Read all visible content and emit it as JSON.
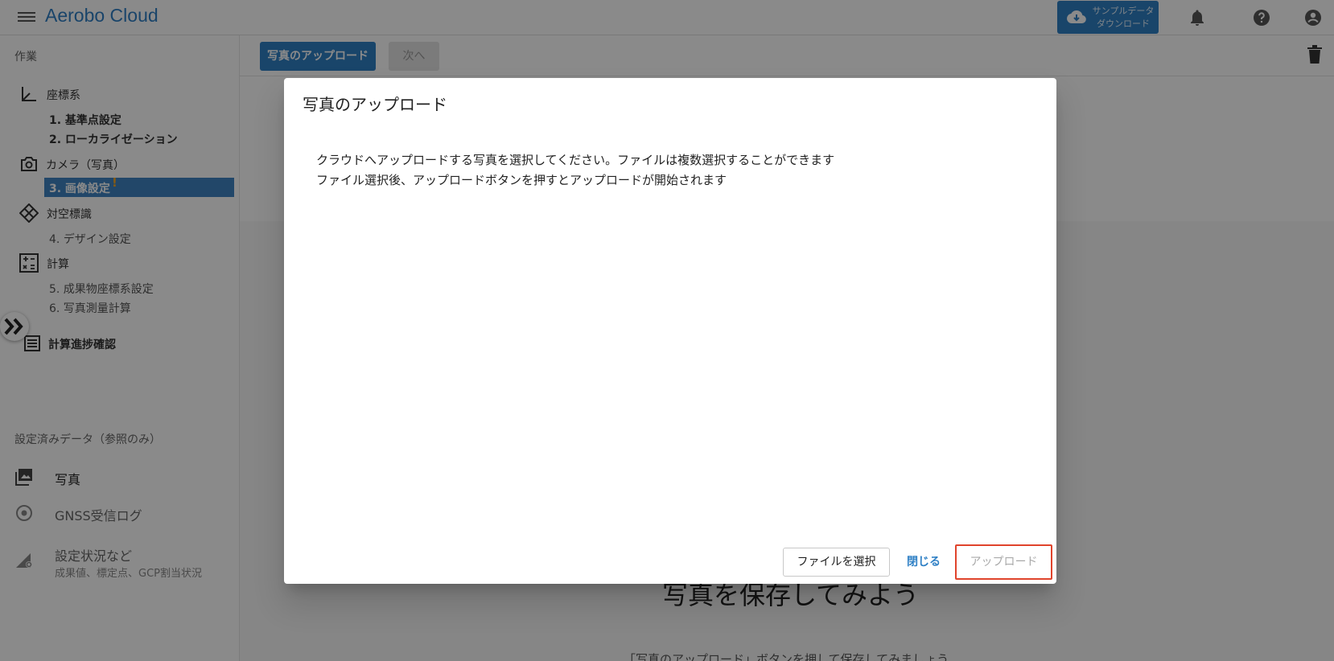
{
  "app": {
    "title": "Aerobo Cloud",
    "sample_button": {
      "line1": "サンプルデータ",
      "line2": "ダウンロード",
      "icon": "cloud-download-icon"
    },
    "icons": [
      "menu-icon",
      "bell-icon",
      "help-icon",
      "account-icon"
    ]
  },
  "sidebar": {
    "section_work": "作業",
    "groups": [
      {
        "label": "座標系",
        "icon": "axis-icon"
      },
      {
        "label": "カメラ（写真）",
        "icon": "camera-icon"
      },
      {
        "label": "対空標識",
        "icon": "target-icon"
      },
      {
        "label": "計算",
        "icon": "calculator-icon"
      }
    ],
    "items": {
      "kijunten": "1. 基準点設定",
      "localization": "2. ローカライゼーション",
      "image_settings": "3. 画像設定",
      "image_settings_badge": "!",
      "design": "4. デザイン設定",
      "coord_system": "5. 成果物座標系設定",
      "photo_calc": "6. 写真測量計算"
    },
    "progress": "計算進捗確認",
    "section_reference": "設定済みデータ（参照のみ）",
    "reference": {
      "photos": "写真",
      "gnss": "GNSS受信ログ",
      "status": "設定状況など",
      "status_sub": "成果値、標定点、GCP割当状況"
    }
  },
  "toolbar": {
    "upload_label": "写真のアップロード",
    "next_label": "次へ"
  },
  "main": {
    "empty_title": "写真を保存してみよう",
    "empty_hint": "「写真のアップロード」ボタンを押して保存してみましょう"
  },
  "dialog": {
    "title": "写真のアップロード",
    "line1": "クラウドへアップロードする写真を選択してください。ファイルは複数選択することができます",
    "line2": "ファイル選択後、アップロードボタンを押すとアップロードが開始されます",
    "select_label": "ファイルを選択",
    "close_label": "閉じる",
    "upload_label": "アップロード"
  },
  "colors": {
    "brand": "#2f80c5",
    "highlight": "#e0442c",
    "warning": "#f5a623"
  }
}
